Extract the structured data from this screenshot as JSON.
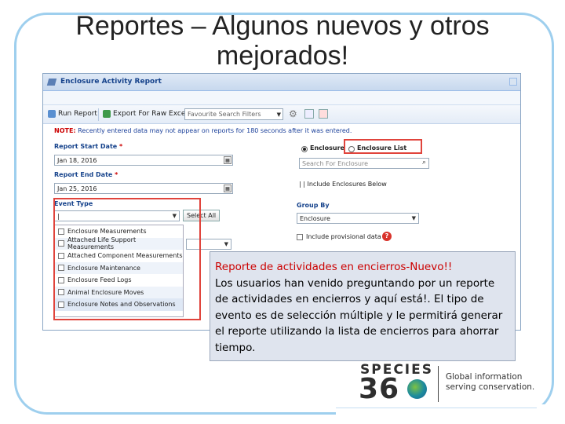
{
  "slide": {
    "title_line1": "Reportes – Algunos nuevos y otros",
    "title_line2": "mejorados!"
  },
  "app": {
    "window_title": "Enclosure Activity Report",
    "toolbar": {
      "run_report": "Run Report",
      "export_raw": "Export For Raw Excel",
      "favourites_placeholder": "Favourite Search Filters"
    },
    "note_label": "NOTE:",
    "note_text": "Recently entered data may not appear on reports for 180 seconds after it was entered.",
    "start_date_label": "Report Start Date",
    "start_date_value": "Jan 18, 2016",
    "end_date_label": "Report End Date",
    "end_date_value": "Jan 25, 2016",
    "required_mark": "*",
    "event_type_label": "Event Type",
    "event_type_value": "|",
    "select_all": "Select All",
    "event_types": [
      "Enclosure Measurements",
      "Attached Life Support Measurements",
      "Attached Component Measurements",
      "Enclosure Maintenance",
      "Enclosure Feed Logs",
      "Animal Enclosure Moves",
      "Enclosure Notes and Observations"
    ],
    "radio_enclosure": "Enclosure",
    "radio_enclosure_list": "Enclosure List",
    "search_enclosure_placeholder": "Search For Enclosure",
    "include_below": "| | Include Enclosures Below",
    "group_by_label": "Group By",
    "group_by_value": "Enclosure",
    "include_provisional": "Include provisional data"
  },
  "callout": {
    "title": "Reporte de actividades en encierros-Nuevo!!",
    "body": "Los usuarios han venido preguntando por un reporte de actividades en encierros y aquí está!. El tipo de evento es de selección múltiple y le permitirá generar el reporte utilizando la lista de encierros para ahorrar tiempo."
  },
  "logo": {
    "species": "SPECIES",
    "number": "36",
    "tagline_line1": "Global information",
    "tagline_line2": "serving conservation."
  },
  "colors": {
    "frame": "#9ecfee",
    "highlight": "#e0443c",
    "callout_title": "#cc0000",
    "header_text": "#15428b"
  }
}
